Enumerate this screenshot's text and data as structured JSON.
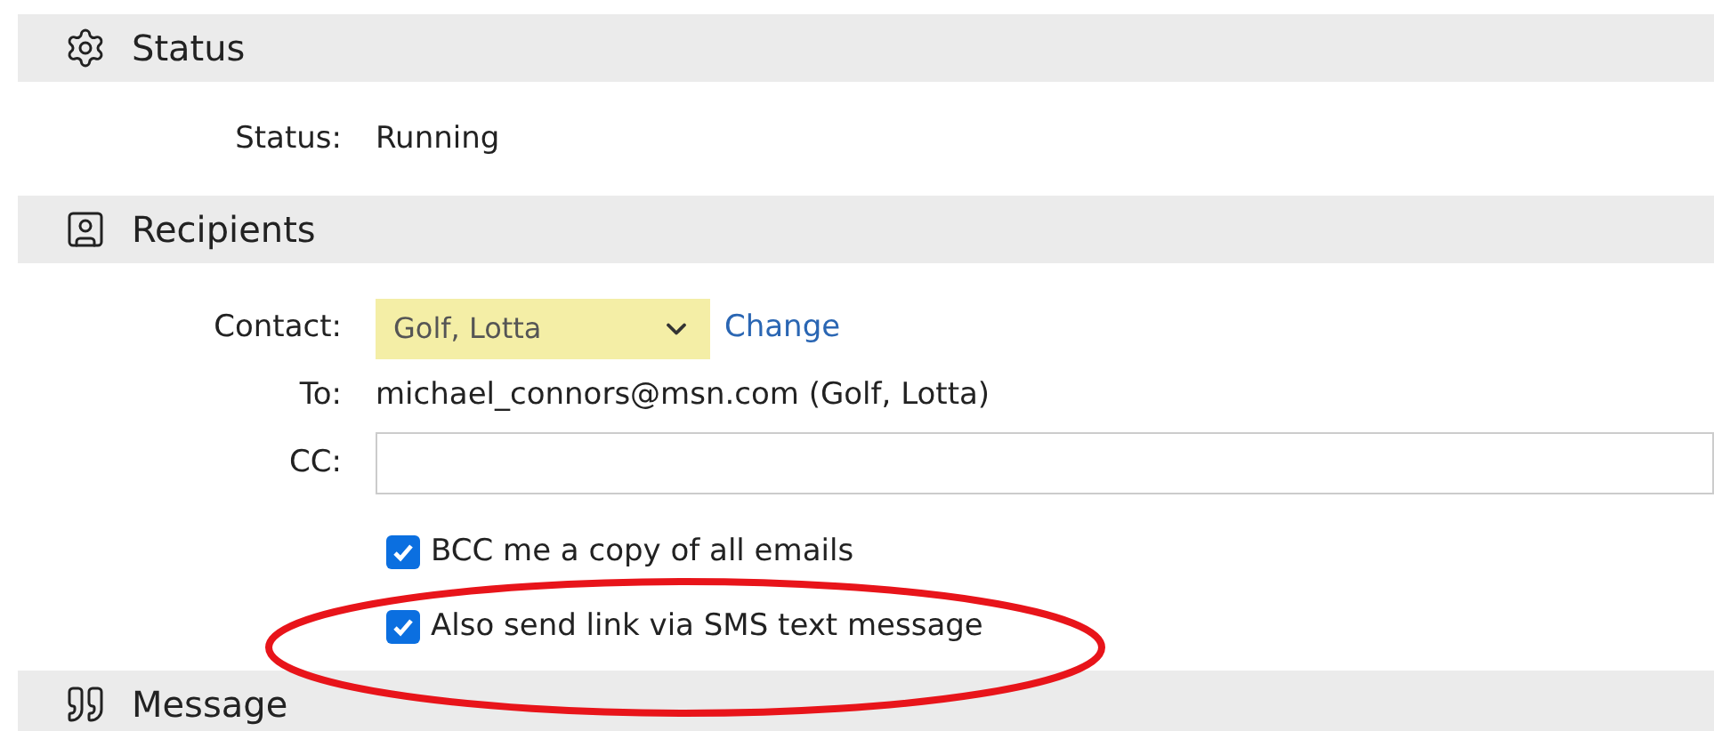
{
  "sections": [
    {
      "kind": "status",
      "title": "Status",
      "fields": [
        {
          "label": "Status:",
          "value": "Running"
        }
      ]
    },
    {
      "kind": "recipients",
      "title": "Recipients",
      "contact": {
        "label": "Contact:",
        "value": "Golf, Lotta",
        "link": "Change"
      },
      "to": {
        "label": "To:",
        "value": "michael_connors@msn.com (Golf, Lotta)"
      },
      "cc": {
        "label": "CC:"
      },
      "options": [
        {
          "label": "BCC me a copy of all emails",
          "checked": true
        },
        {
          "label": "Also send link via SMS text message",
          "checked": true
        }
      ]
    },
    {
      "kind": "message",
      "title": "Message"
    }
  ],
  "annotation": {
    "kind": "ellipse",
    "color": "#e8141a"
  }
}
